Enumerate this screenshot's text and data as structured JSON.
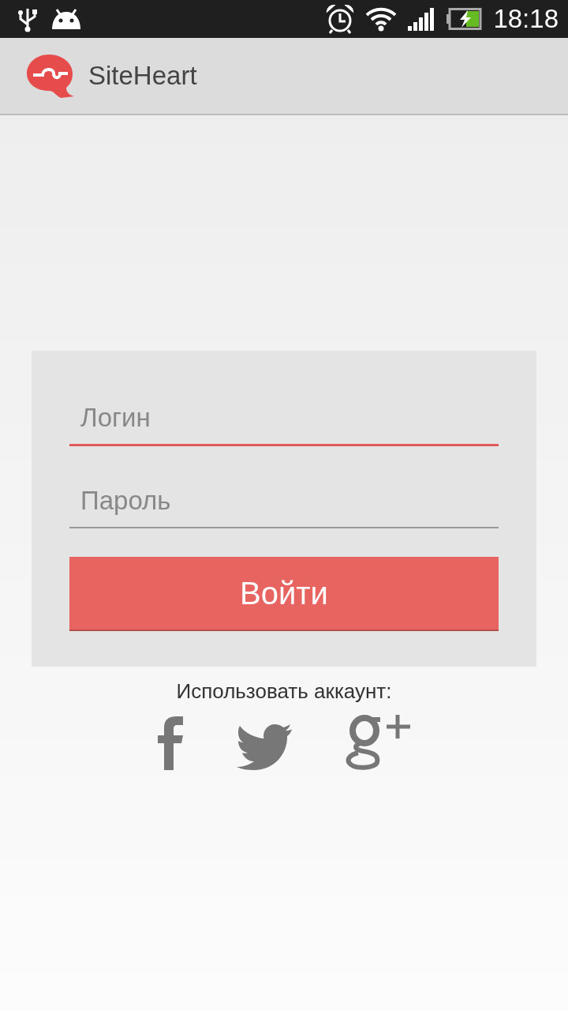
{
  "status_bar": {
    "time": "18:18"
  },
  "app_bar": {
    "title": "SiteHeart"
  },
  "login_form": {
    "fields": [
      {
        "placeholder": "Логин",
        "focused": true
      },
      {
        "placeholder": "Пароль",
        "focused": false
      }
    ],
    "submit_button": "Войти"
  },
  "social": {
    "label": "Использовать аккаунт:",
    "networks": [
      {
        "kind": "facebook"
      },
      {
        "kind": "twitter"
      },
      {
        "kind": "googleplus"
      }
    ]
  }
}
